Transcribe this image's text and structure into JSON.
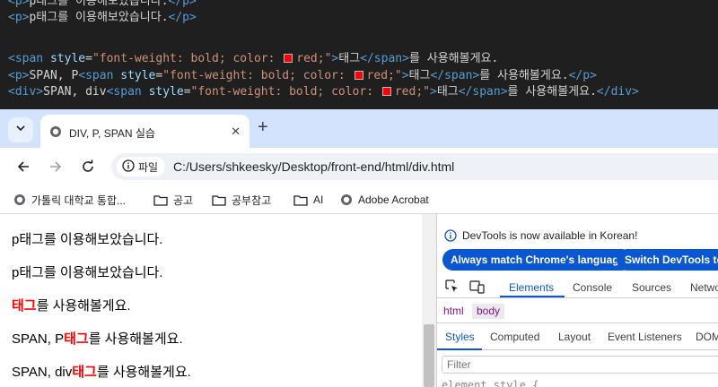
{
  "editor": {
    "line1": {
      "open": "<p>",
      "text": "p태그를 이용해보았습니다.",
      "close": "</p>"
    },
    "line2": {
      "open": "<p>",
      "text": "p태그를 이용해보았습니다.",
      "close": "</p>"
    },
    "line3": {
      "open": "<span ",
      "attr": "style",
      "eq": "=",
      "q1": "\"font-weight: bold; color: ",
      "color": "red",
      "q2": ";\"",
      "gt": ">",
      "inner": "태그",
      "close": "</span>",
      "after": "를 사용해볼게요."
    },
    "line4": {
      "open1": "<p>",
      "text1": "SPAN, P",
      "open": "<span ",
      "attr": "style",
      "eq": "=",
      "q1": "\"font-weight: bold; color: ",
      "color": "red",
      "q2": ";\"",
      "gt": ">",
      "inner": "태그",
      "close": "</span>",
      "after": "를 사용해볼게요.",
      "close1": "</p>"
    },
    "line5": {
      "open1": "<div>",
      "text1": "SPAN, div",
      "open": "<span ",
      "attr": "style",
      "eq": "=",
      "q1": "\"font-weight: bold; color: ",
      "color": "red",
      "q2": ";\"",
      "gt": ">",
      "inner": "태그",
      "close": "</span>",
      "after": "를 사용해볼게요.",
      "close1": "</div>"
    },
    "swatch_color": "#ff0000"
  },
  "browser": {
    "tab_title": "DIV, P, SPAN 실습",
    "site_chip_label": "파일",
    "url": "C:/Users/shkeesky/Desktop/front-end/html/div.html",
    "bookmarks": [
      {
        "label": "가톨릭 대학교 통합...",
        "icon": "globe-icon"
      },
      {
        "label": "공고",
        "icon": "folder-icon"
      },
      {
        "label": "공부참고",
        "icon": "folder-icon"
      },
      {
        "label": "AI",
        "icon": "folder-icon"
      },
      {
        "label": "Adobe Acrobat",
        "icon": "globe-icon"
      }
    ]
  },
  "page": {
    "p1": "p태그를 이용해보았습니다.",
    "p2": "p태그를 이용해보았습니다.",
    "span_line": {
      "strong": "태그",
      "after": "를 사용해볼게요."
    },
    "p_line": {
      "before": "SPAN, P",
      "strong": "태그",
      "after": "를 사용해볼게요."
    },
    "div_line": {
      "before": "SPAN, div",
      "strong": "태그",
      "after": "를 사용해볼게요."
    }
  },
  "devtools": {
    "info_text": "DevTools is now available in Korean!",
    "btn_match": "Always match Chrome's language",
    "btn_switch": "Switch DevTools to K",
    "tabs": [
      "Elements",
      "Console",
      "Sources",
      "Netwo"
    ],
    "active_tab": "Elements",
    "crumbs": [
      "html",
      "body"
    ],
    "subtabs": [
      "Styles",
      "Computed",
      "Layout",
      "Event Listeners",
      "DOM"
    ],
    "active_subtab": "Styles",
    "filter_placeholder": "Filter",
    "element_style": "element.style {"
  }
}
